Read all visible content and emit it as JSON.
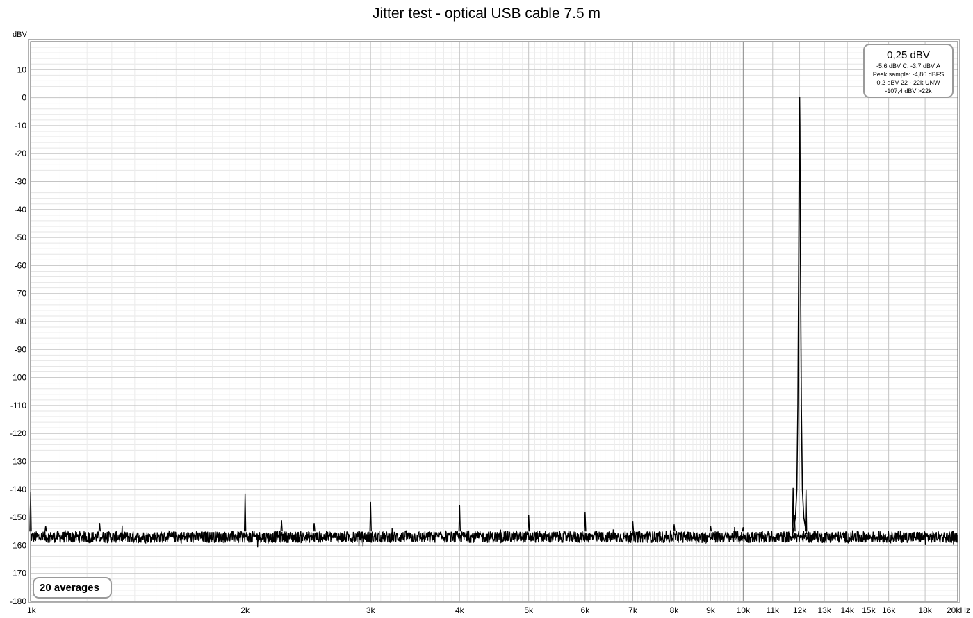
{
  "chart_data": {
    "type": "line",
    "title": "Jitter test - optical USB cable 7.5 m",
    "ylabel": "dBV",
    "x_unit": "kHz",
    "xscale": "log",
    "xlim": [
      1000,
      20000
    ],
    "ylim": [
      -180,
      20
    ],
    "grid": true,
    "y_ticks": [
      10,
      0,
      -10,
      -20,
      -30,
      -40,
      -50,
      -60,
      -70,
      -80,
      -90,
      -100,
      -110,
      -120,
      -130,
      -140,
      -150,
      -160,
      -170,
      -180
    ],
    "y_tick_labels": [
      "10",
      "0",
      "-10",
      "-20",
      "-30",
      "-40",
      "-50",
      "-60",
      "-70",
      "-80",
      "-90",
      "-100",
      "-110",
      "-120",
      "-130",
      "-140",
      "-150",
      "-160",
      "-170",
      "-180"
    ],
    "x_ticks": [
      {
        "value": 1000,
        "label": "1k"
      },
      {
        "value": 2000,
        "label": "2k"
      },
      {
        "value": 3000,
        "label": "3k"
      },
      {
        "value": 4000,
        "label": "4k"
      },
      {
        "value": 5000,
        "label": "5k"
      },
      {
        "value": 6000,
        "label": "6k"
      },
      {
        "value": 7000,
        "label": "7k"
      },
      {
        "value": 8000,
        "label": "8k"
      },
      {
        "value": 9000,
        "label": "9k"
      },
      {
        "value": 10000,
        "label": "10k"
      },
      {
        "value": 11000,
        "label": "11k"
      },
      {
        "value": 12000,
        "label": "12k"
      },
      {
        "value": 13000,
        "label": "13k"
      },
      {
        "value": 14000,
        "label": "14k"
      },
      {
        "value": 15000,
        "label": "15k"
      },
      {
        "value": 16000,
        "label": "16k"
      },
      {
        "value": 18000,
        "label": "18k"
      },
      {
        "value": 20000,
        "label": "20kHz"
      }
    ],
    "noise_floor_dBV": -157,
    "series": [
      {
        "color": "#000000",
        "peaks": [
          {
            "x": 1000,
            "y": -141
          },
          {
            "x": 1050,
            "y": -153
          },
          {
            "x": 1250,
            "y": -152
          },
          {
            "x": 2000,
            "y": -141.5
          },
          {
            "x": 2250,
            "y": -151
          },
          {
            "x": 2500,
            "y": -152
          },
          {
            "x": 3000,
            "y": -144.5
          },
          {
            "x": 4000,
            "y": -145.5
          },
          {
            "x": 5000,
            "y": -149
          },
          {
            "x": 6000,
            "y": -148
          },
          {
            "x": 7000,
            "y": -151.5
          },
          {
            "x": 8000,
            "y": -152.5
          },
          {
            "x": 9000,
            "y": -153
          },
          {
            "x": 10000,
            "y": -153.5
          },
          {
            "x": 11750,
            "y": -139.5
          },
          {
            "x": 11800,
            "y": -149
          },
          {
            "x": 12000,
            "y": 0.25
          },
          {
            "x": 12250,
            "y": -140
          }
        ]
      }
    ]
  },
  "readout": {
    "main": "0,25 dBV",
    "line1": "-5,6 dBV C, -3,7 dBV A",
    "line2": "Peak sample: -4,86 dBFS",
    "line3": "0,2 dBV 22 - 22k UNW",
    "line4": "-107,4 dBV >22k"
  },
  "averages_label": "20 averages"
}
